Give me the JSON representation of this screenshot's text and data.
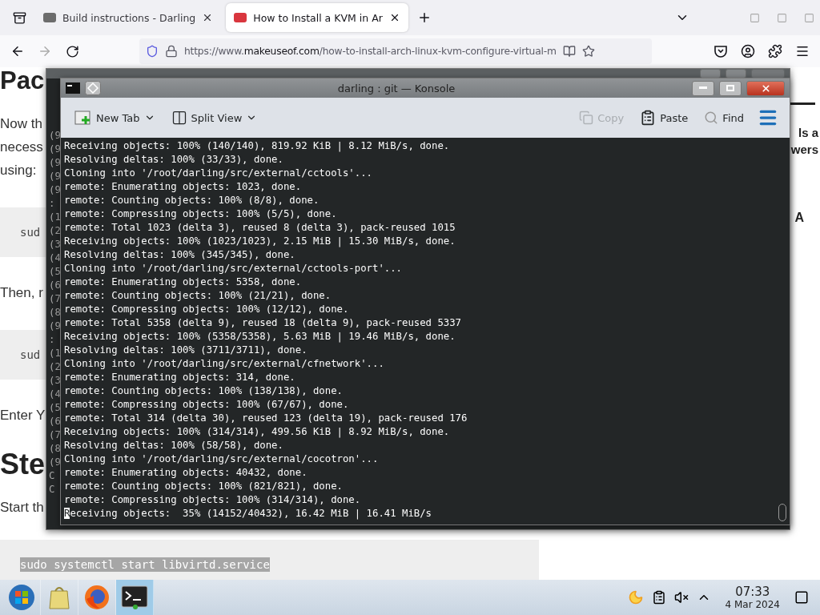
{
  "browser": {
    "tabs": [
      {
        "title": "Build instructions - Darling",
        "selected": false
      },
      {
        "title": "How to Install a KVM in Ar",
        "selected": true
      }
    ],
    "url": {
      "scheme": "https://www.",
      "domain": "makeuseof.com",
      "path": "/how-to-install-arch-linux-kvm-configure-virtual-m"
    }
  },
  "page": {
    "left": [
      {
        "kind": "heading",
        "text": "Pac"
      },
      {
        "kind": "paragraph",
        "lines": [
          "Now th",
          "necess",
          "using:"
        ]
      },
      {
        "kind": "code",
        "text": "sud",
        "highlighted": false
      },
      {
        "kind": "paragraph",
        "lines": [
          "Then, r"
        ]
      },
      {
        "kind": "code",
        "text": "sud",
        "highlighted": false
      },
      {
        "kind": "paragraph",
        "lines": [
          "Enter Y"
        ]
      },
      {
        "kind": "heading",
        "text": "Ste"
      },
      {
        "kind": "paragraph",
        "lines": [
          "Start th"
        ]
      },
      {
        "kind": "code",
        "text": "sudo systemctl start libvirtd.service",
        "highlighted": true
      }
    ],
    "right_lines": [
      "ls a",
      "wers"
    ],
    "right_letter": "A"
  },
  "back_terminal": {
    "lines": [
      "(9",
      "(9",
      "(9",
      "(9",
      "(9",
      ":",
      "(1",
      "(2",
      "(3",
      "(4",
      "(5",
      "(6",
      "(7",
      "(8",
      "(9",
      ":",
      "(1",
      "(2",
      "(3",
      "(4",
      "(5",
      "(6",
      "(7",
      "(8",
      "(9",
      "C",
      "C"
    ]
  },
  "konsole": {
    "title": "darling : git — Konsole",
    "toolbar": [
      {
        "kind": "newtab",
        "label": "New Tab",
        "disabled": false
      },
      {
        "kind": "split",
        "label": "Split View",
        "disabled": false
      },
      {
        "kind": "copy",
        "label": "Copy",
        "disabled": true
      },
      {
        "kind": "paste",
        "label": "Paste",
        "disabled": false
      },
      {
        "kind": "find",
        "label": "Find",
        "disabled": false
      }
    ],
    "cursor": true,
    "lines": [
      "Receiving objects: 100% (140/140), 819.92 KiB | 8.12 MiB/s, done.",
      "Resolving deltas: 100% (33/33), done.",
      "Cloning into '/root/darling/src/external/cctools'...",
      "remote: Enumerating objects: 1023, done.",
      "remote: Counting objects: 100% (8/8), done.",
      "remote: Compressing objects: 100% (5/5), done.",
      "remote: Total 1023 (delta 3), reused 8 (delta 3), pack-reused 1015",
      "Receiving objects: 100% (1023/1023), 2.15 MiB | 15.30 MiB/s, done.",
      "Resolving deltas: 100% (345/345), done.",
      "Cloning into '/root/darling/src/external/cctools-port'...",
      "remote: Enumerating objects: 5358, done.",
      "remote: Counting objects: 100% (21/21), done.",
      "remote: Compressing objects: 100% (12/12), done.",
      "remote: Total 5358 (delta 9), reused 18 (delta 9), pack-reused 5337",
      "Receiving objects: 100% (5358/5358), 5.63 MiB | 19.46 MiB/s, done.",
      "Resolving deltas: 100% (3711/3711), done.",
      "Cloning into '/root/darling/src/external/cfnetwork'...",
      "remote: Enumerating objects: 314, done.",
      "remote: Counting objects: 100% (138/138), done.",
      "remote: Compressing objects: 100% (67/67), done.",
      "remote: Total 314 (delta 30), reused 123 (delta 19), pack-reused 176",
      "Receiving objects: 100% (314/314), 499.56 KiB | 8.92 MiB/s, done.",
      "Resolving deltas: 100% (58/58), done.",
      "Cloning into '/root/darling/src/external/cocotron'...",
      "remote: Enumerating objects: 40432, done.",
      "remote: Counting objects: 100% (821/821), done.",
      "remote: Compressing objects: 100% (314/314), done.",
      "Receiving objects:  35% (14152/40432), 16.42 MiB | 16.41 MiB/s"
    ]
  },
  "taskbar": {
    "apps": [
      {
        "kind": "start",
        "active": false
      },
      {
        "kind": "files",
        "active": false
      },
      {
        "kind": "firefox",
        "active": false
      },
      {
        "kind": "terminal",
        "active": true
      }
    ],
    "time": "07:33",
    "date": "4 Mar 2024"
  }
}
